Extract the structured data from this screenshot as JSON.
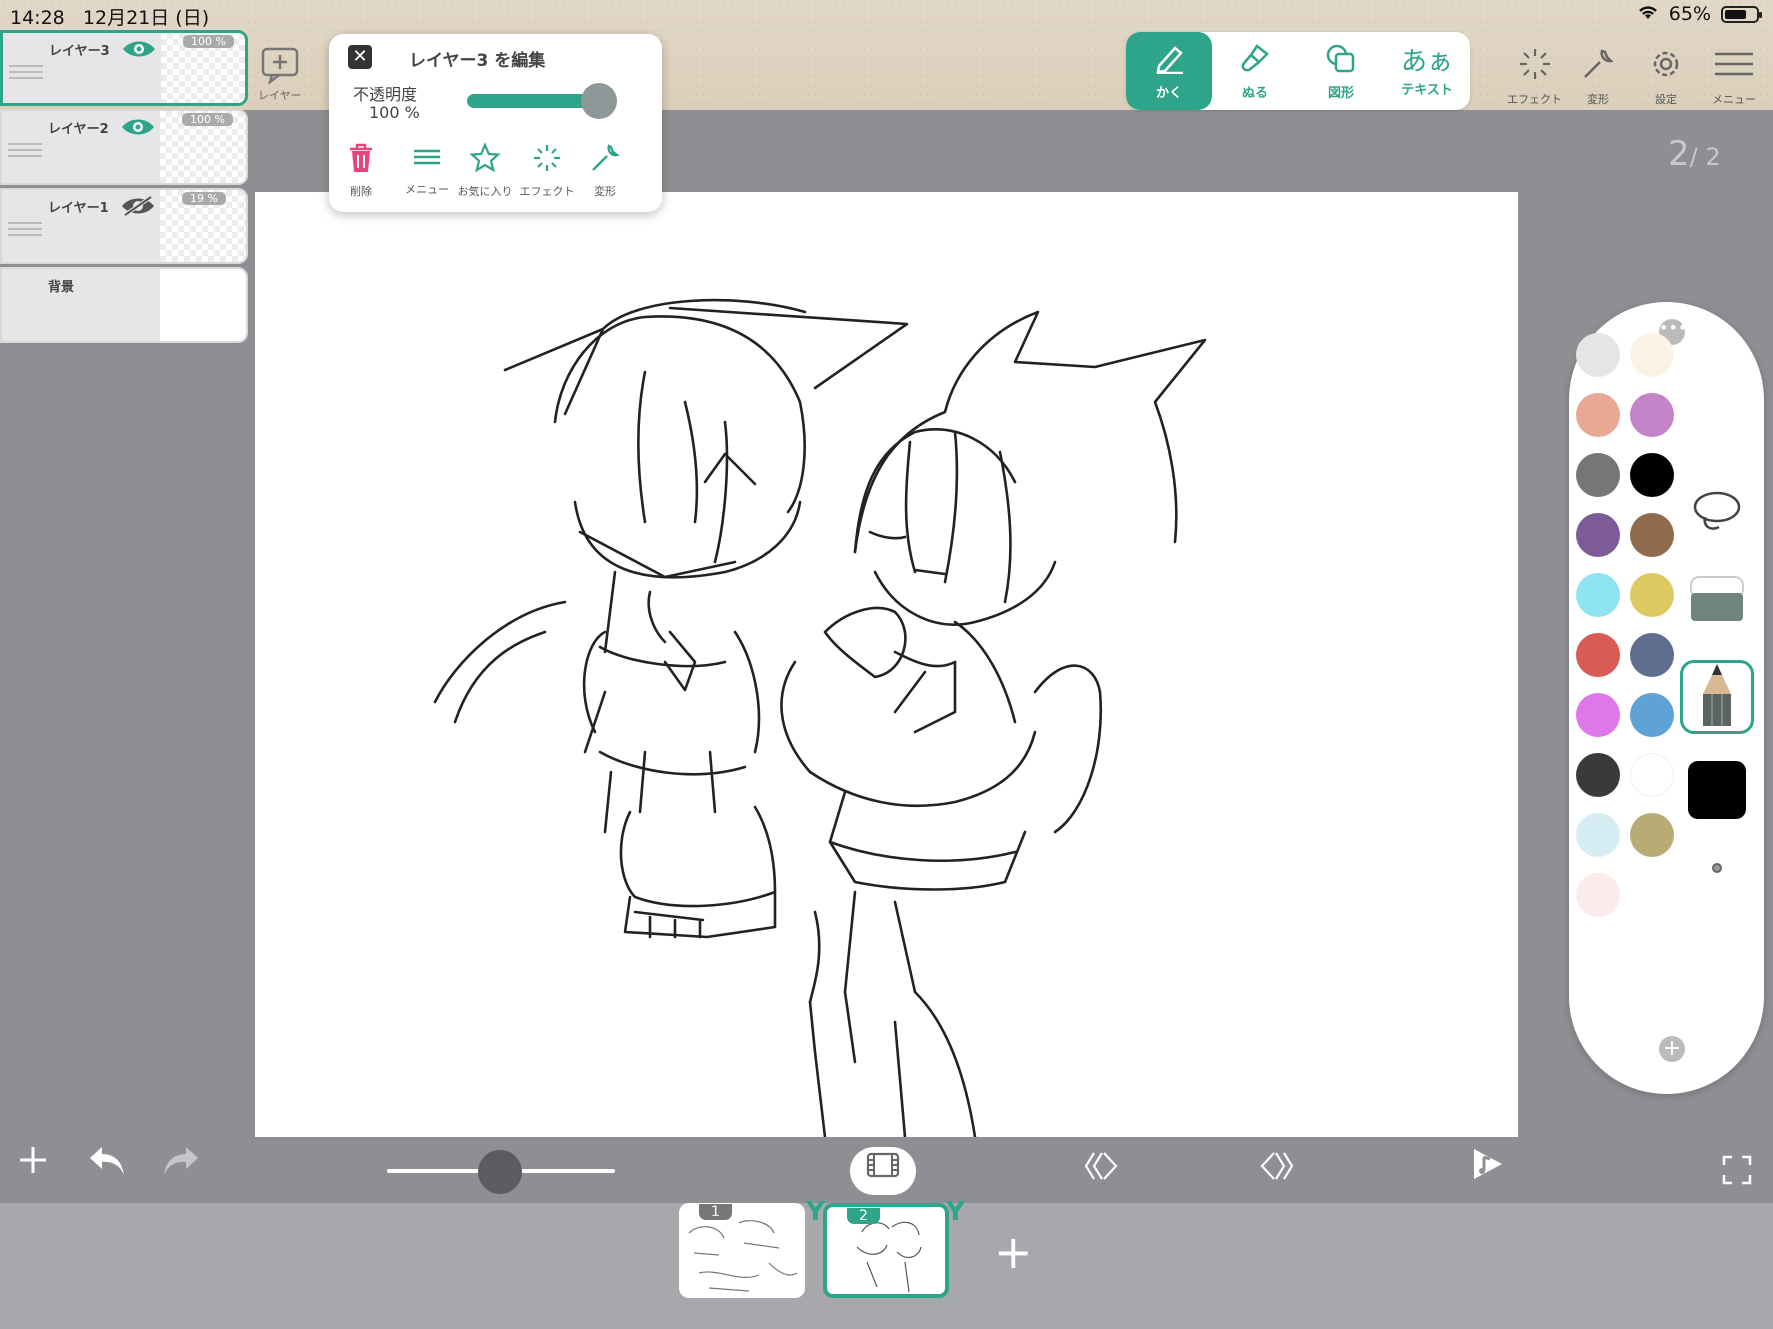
{
  "status": {
    "time": "14:28",
    "date": "12月21日 (日)",
    "battery": "65%"
  },
  "tool_tabs": [
    {
      "label": "かく",
      "icon": "pencil-icon",
      "active": true
    },
    {
      "label": "ぬる",
      "icon": "brush-icon",
      "active": false
    },
    {
      "label": "図形",
      "icon": "shapes-icon",
      "active": false
    },
    {
      "label": "テキスト",
      "icon": "text-icon",
      "glyph": "あぁ",
      "active": false
    }
  ],
  "right_tools": [
    {
      "label": "エフェクト",
      "icon": "sparkle-icon"
    },
    {
      "label": "変形",
      "icon": "wrench-icon"
    },
    {
      "label": "設定",
      "icon": "gear-icon"
    },
    {
      "label": "メニュー",
      "icon": "hamburger-icon"
    }
  ],
  "layers": [
    {
      "name": "レイヤー3",
      "opacity": "100 %",
      "visible": true,
      "selected": true
    },
    {
      "name": "レイヤー2",
      "opacity": "100 %",
      "visible": true,
      "selected": false
    },
    {
      "name": "レイヤー1",
      "opacity": "19 %",
      "visible": false,
      "selected": false
    },
    {
      "name": "背景",
      "opacity": "",
      "visible": true,
      "selected": false
    }
  ],
  "layer_add_label": "レイヤー",
  "popup": {
    "title": "レイヤー3 を編集",
    "opacity_label": "不透明度",
    "opacity_value": "100 %",
    "opacity": 1.0,
    "actions": [
      {
        "label": "削除",
        "icon": "trash-icon"
      },
      {
        "label": "メニュー",
        "icon": "menu-lines-icon"
      },
      {
        "label": "お気に入り",
        "icon": "star-icon"
      },
      {
        "label": "エフェクト",
        "icon": "sparkle-icon"
      },
      {
        "label": "変形",
        "icon": "wrench-icon"
      }
    ]
  },
  "page_indicator": {
    "current": "2",
    "total": "/ 2"
  },
  "palette": {
    "colors": [
      "#e6e5e3",
      "#fbf3e6",
      "#e9a893",
      "#c584c8",
      "#767676",
      "#000000",
      "#7d5b97",
      "#8f6a4d",
      "#8ee4f0",
      "#ddc962",
      "#d85b56",
      "#5f6d8f",
      "#df77ea",
      "#5fa3d6",
      "#3a3a3a",
      "#ffffff",
      "#d6eef3",
      "#b8ab74",
      "#fbeceb"
    ],
    "current_color": "#000000"
  },
  "zoom": {
    "level": 0.45
  },
  "frames": [
    {
      "number": "1",
      "selected": false
    },
    {
      "number": "2",
      "selected": true
    }
  ]
}
